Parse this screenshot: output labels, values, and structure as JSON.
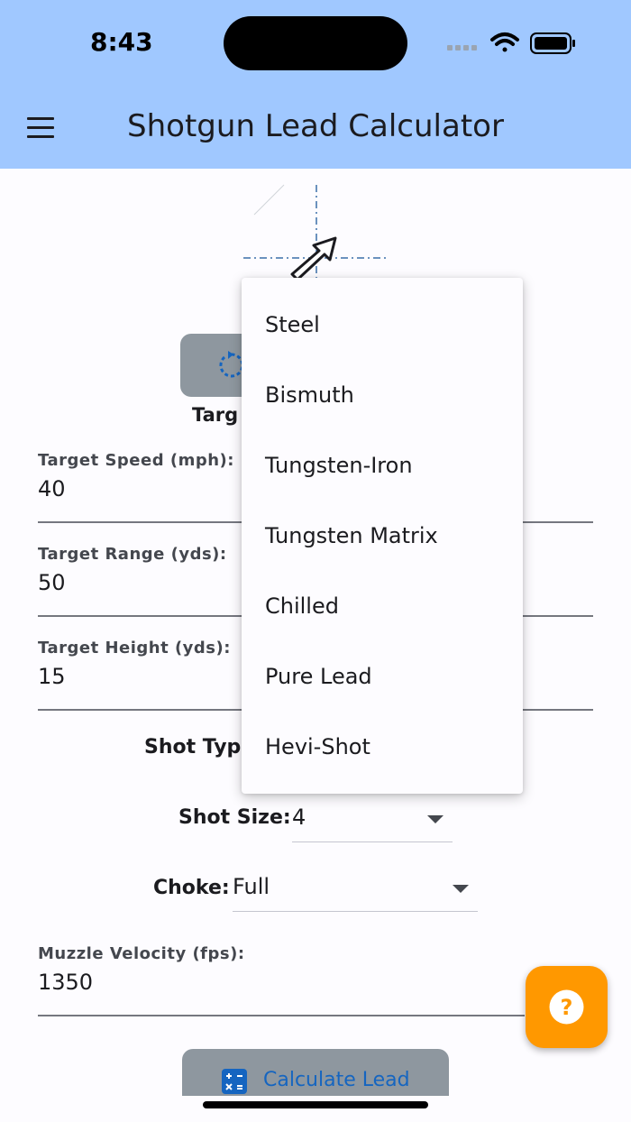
{
  "status_bar": {
    "time": "8:43"
  },
  "app_bar": {
    "title": "Shotgun Lead Calculator",
    "menu_icon": "hamburger-menu-icon"
  },
  "target_section": {
    "heading": "Targ"
  },
  "fields": {
    "target_speed": {
      "label": "Target Speed (mph):",
      "value": "40"
    },
    "target_range": {
      "label": "Target Range (yds):",
      "value": "50"
    },
    "target_height": {
      "label": "Target Height (yds):",
      "value": "15"
    },
    "muzzle_velocity": {
      "label": "Muzzle Velocity (fps):",
      "value": "1350"
    }
  },
  "shot_type": {
    "label": "Shot Typ"
  },
  "shot_size": {
    "label": "Shot Size:",
    "value": "4"
  },
  "choke": {
    "label": "Choke:",
    "value": "Full"
  },
  "calculate_button": {
    "label": "Calculate Lead",
    "icon": "calculator-icon"
  },
  "help_fab": {
    "icon": "help-question-icon"
  },
  "shot_type_menu": {
    "items": [
      "Steel",
      "Bismuth",
      "Tungsten-Iron",
      "Tungsten Matrix",
      "Chilled",
      "Pure Lead",
      "Hevi-Shot"
    ]
  },
  "colors": {
    "app_bar": "#a0c8ff",
    "button_bg": "#8e979f",
    "accent_blue": "#1565c0",
    "fab": "#ff9800"
  }
}
